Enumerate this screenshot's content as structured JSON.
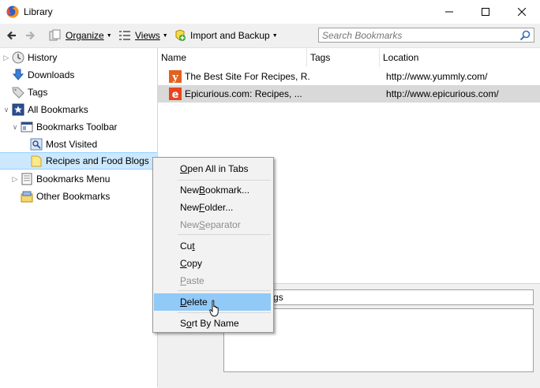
{
  "window": {
    "title": "Library"
  },
  "toolbar": {
    "organize": "Organize",
    "views": "Views",
    "import_backup": "Import and Backup",
    "search_placeholder": "Search Bookmarks"
  },
  "sidebar": {
    "items": [
      {
        "label": "History"
      },
      {
        "label": "Downloads"
      },
      {
        "label": "Tags"
      },
      {
        "label": "All Bookmarks"
      },
      {
        "label": "Bookmarks Toolbar"
      },
      {
        "label": "Most Visited"
      },
      {
        "label": "Recipes and Food Blogs"
      },
      {
        "label": "Bookmarks Menu"
      },
      {
        "label": "Other Bookmarks"
      }
    ]
  },
  "list": {
    "columns": [
      "Name",
      "Tags",
      "Location"
    ],
    "rows": [
      {
        "name": "The Best Site For Recipes, R...",
        "tags": "",
        "location": "http://www.yummly.com/"
      },
      {
        "name": "Epicurious.com: Recipes, ...",
        "tags": "",
        "location": "http://www.epicurious.com/"
      }
    ]
  },
  "details": {
    "name_value": "d Food Blogs"
  },
  "context_menu": {
    "items": [
      {
        "pre": "",
        "acc": "O",
        "post": "pen All in Tabs"
      },
      {
        "pre": "New ",
        "acc": "B",
        "post": "ookmark..."
      },
      {
        "pre": "New ",
        "acc": "F",
        "post": "older..."
      },
      {
        "pre": "New ",
        "acc": "S",
        "post": "eparator"
      },
      {
        "pre": "Cu",
        "acc": "t",
        "post": ""
      },
      {
        "pre": "",
        "acc": "C",
        "post": "opy"
      },
      {
        "pre": "",
        "acc": "P",
        "post": "aste"
      },
      {
        "pre": "",
        "acc": "D",
        "post": "elete"
      },
      {
        "pre": "S",
        "acc": "o",
        "post": "rt By Name"
      }
    ]
  },
  "colors": {
    "sidebar_selected": "#cce8ff",
    "menu_hover": "#91c9f7",
    "row_selected": "#d9d9d9"
  }
}
